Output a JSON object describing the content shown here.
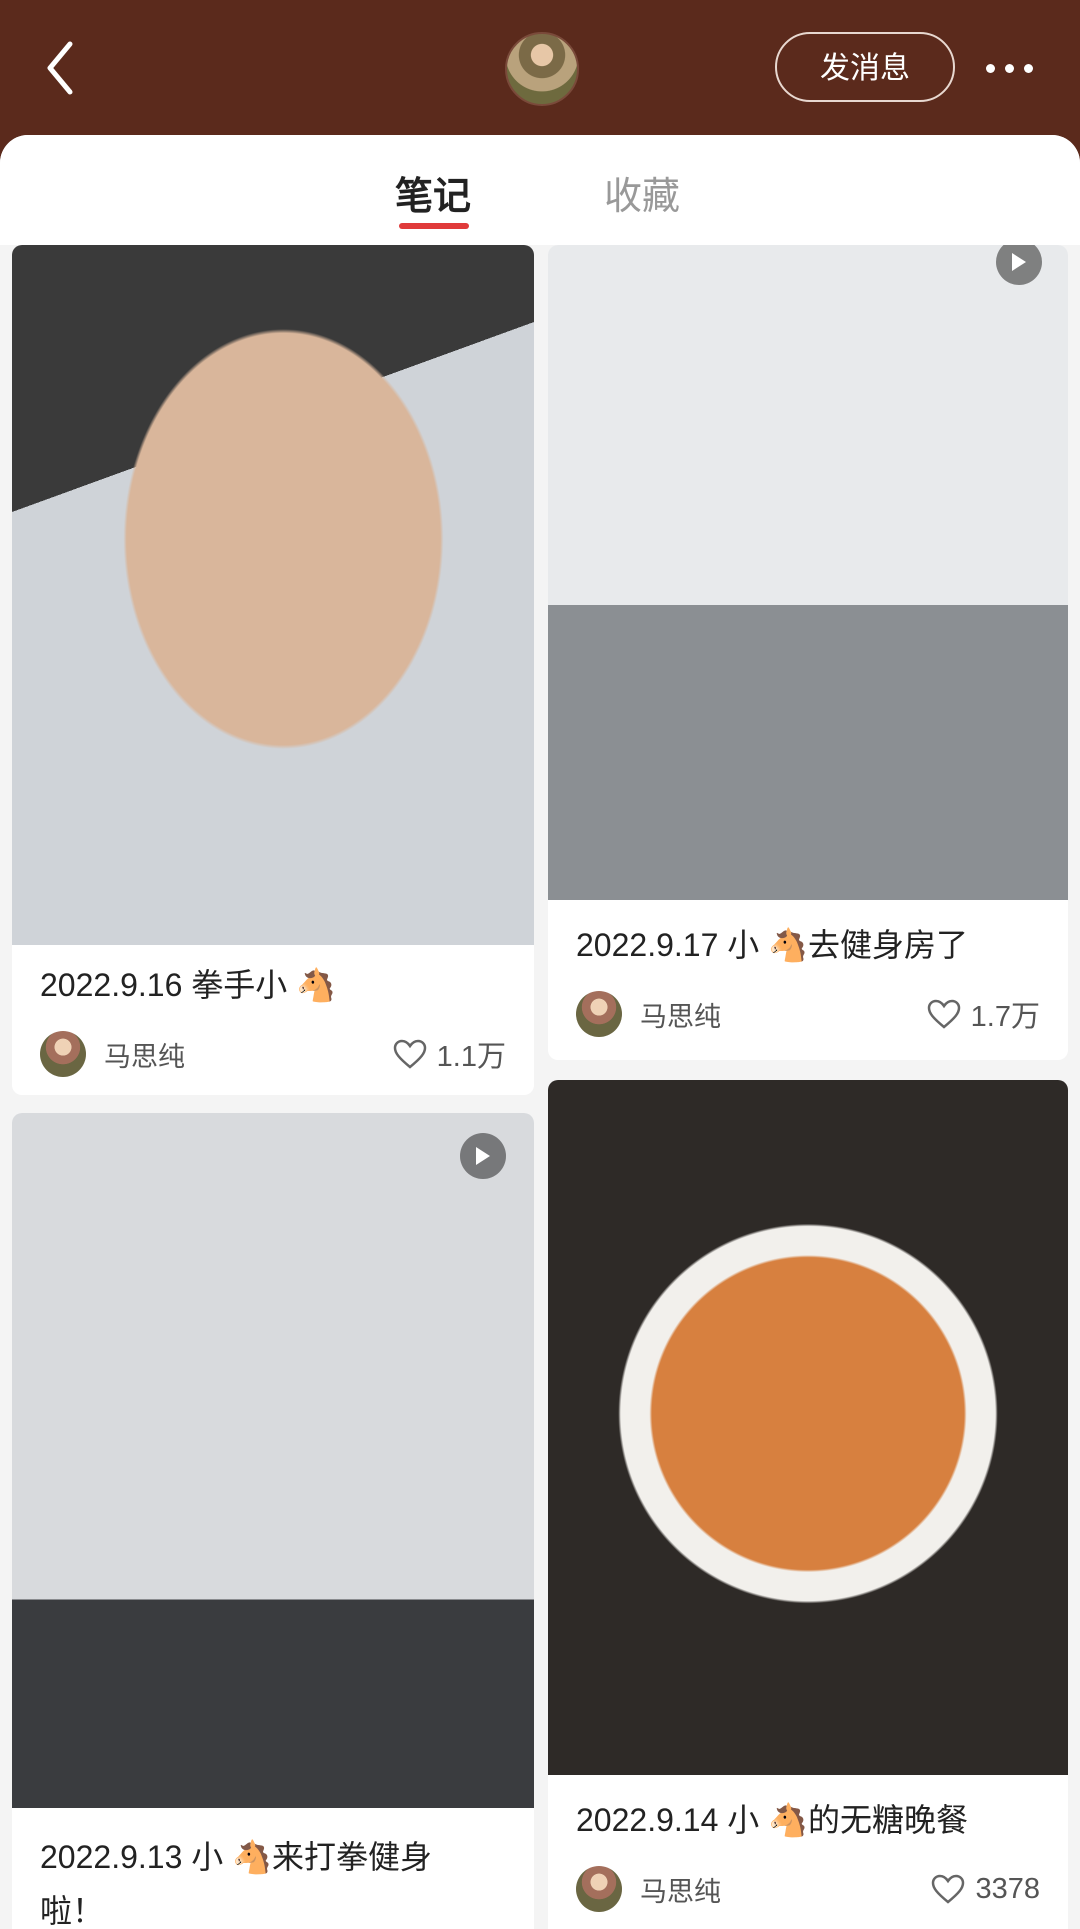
{
  "header": {
    "send_message": "发消息",
    "icons": {
      "back": "chevron-left-icon",
      "more": "more-dots-icon"
    }
  },
  "tabs": [
    {
      "label": "笔记",
      "active": true
    },
    {
      "label": "收藏",
      "active": false
    }
  ],
  "colors": {
    "header_bg": "#5b2a1c",
    "tab_indicator": "#e03a3a"
  },
  "notes": [
    {
      "title": "2022.9.16 拳手小 🐴",
      "author": "马思纯",
      "likes": "1.1万",
      "video": false
    },
    {
      "title": "2022.9.17 小 🐴去健身房了",
      "author": "马思纯",
      "likes": "1.7万",
      "video": true
    },
    {
      "title_line1": "2022.9.13 小 🐴来打拳健身",
      "title_line2": "啦！",
      "video": true
    },
    {
      "title": "2022.9.14 小 🐴的无糖晚餐",
      "author": "马思纯",
      "likes": "3378",
      "video": false
    }
  ]
}
